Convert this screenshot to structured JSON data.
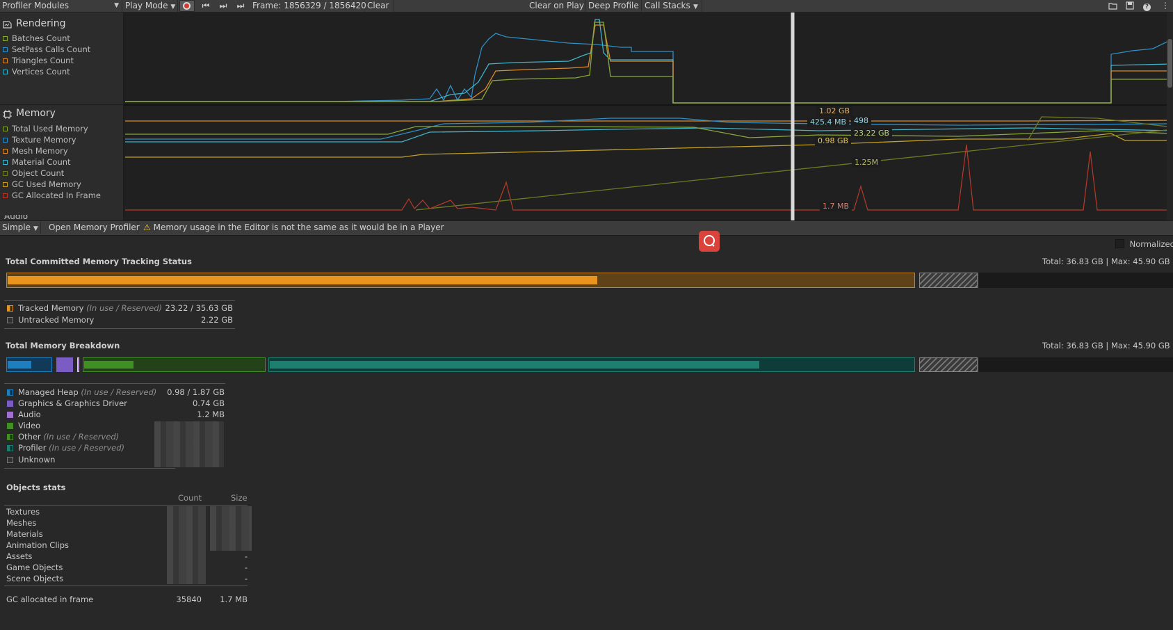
{
  "toolbar": {
    "modules_label": "Profiler Modules",
    "play_mode_label": "Play Mode",
    "frame_label": "Frame: 1856329 / 1856420",
    "clear_label": "Clear",
    "clear_on_play_label": "Clear on Play",
    "deep_profile_label": "Deep Profile",
    "call_stacks_label": "Call Stacks"
  },
  "rendering": {
    "title": "Rendering",
    "legend": [
      {
        "label": "Batches Count",
        "color": "#8aa83a"
      },
      {
        "label": "SetPass Calls Count",
        "color": "#2f8fc7"
      },
      {
        "label": "Triangles Count",
        "color": "#d98b2b"
      },
      {
        "label": "Vertices Count",
        "color": "#3fb3c8"
      }
    ]
  },
  "memory_module": {
    "title": "Memory",
    "legend": [
      {
        "label": "Total Used Memory",
        "color": "#8aa83a"
      },
      {
        "label": "Texture Memory",
        "color": "#2f8fc7"
      },
      {
        "label": "Mesh Memory",
        "color": "#d98b2b"
      },
      {
        "label": "Material Count",
        "color": "#3fb3c8"
      },
      {
        "label": "Object Count",
        "color": "#6e7a22"
      },
      {
        "label": "GC Used Memory",
        "color": "#c2a124"
      },
      {
        "label": "GC Allocated In Frame",
        "color": "#b83a2a"
      }
    ],
    "next_module": "Audio",
    "readouts": {
      "r1": "1.02 GB",
      "r2": "425.4 MB",
      "r3": "498",
      "r4": "23.22 GB",
      "r5": "0.98 GB",
      "r6": "1.25M",
      "r7": "1.7 MB"
    }
  },
  "detail_toolbar": {
    "view_mode": "Simple",
    "open_memory_profiler": "Open Memory Profiler",
    "warning": "Memory usage in the Editor is not the same as it would be in a Player"
  },
  "normalized_label": "Normalized",
  "committed": {
    "title": "Total Committed Memory Tracking Status",
    "total": "Total: 36.83 GB | Max: 45.90 GB",
    "tracked_fill": 0.651,
    "rows": [
      {
        "label": "Tracked Memory",
        "note": "(In use / Reserved)",
        "value": "23.22 / 35.63 GB",
        "color": "#e8941e"
      },
      {
        "label": "Untracked Memory",
        "note": "",
        "value": "2.22 GB",
        "color": "#555555"
      }
    ]
  },
  "breakdown": {
    "title": "Total Memory Breakdown",
    "total": "Total: 36.83 GB | Max: 45.90 GB",
    "rows": [
      {
        "label": "Managed Heap",
        "note": "(In use / Reserved)",
        "value": "0.98 / 1.87 GB",
        "color": "#1d7fc0"
      },
      {
        "label": "Graphics & Graphics Driver",
        "note": "",
        "value": "0.74 GB",
        "color": "#7b5cc4"
      },
      {
        "label": "Audio",
        "note": "",
        "value": "1.2 MB",
        "color": "#a070d0"
      },
      {
        "label": "Video",
        "note": "",
        "value": "",
        "color": "#3f8f22"
      },
      {
        "label": "Other",
        "note": "(In use / Reserved)",
        "value": "",
        "color": "#3f8f22"
      },
      {
        "label": "Profiler",
        "note": "(In use / Reserved)",
        "value": "",
        "color": "#1d7f6f"
      },
      {
        "label": "Unknown",
        "note": "",
        "value": "",
        "color": "#555555"
      }
    ]
  },
  "objects": {
    "title": "Objects stats",
    "col_count": "Count",
    "col_size": "Size",
    "rows": [
      {
        "label": "Textures",
        "size": ""
      },
      {
        "label": "Meshes",
        "size": ""
      },
      {
        "label": "Materials",
        "size": ""
      },
      {
        "label": "Animation Clips",
        "size": ""
      },
      {
        "label": "Assets",
        "size": "-"
      },
      {
        "label": "Game Objects",
        "size": "-"
      },
      {
        "label": "Scene Objects",
        "size": "-"
      }
    ],
    "gc": {
      "label": "GC allocated in frame",
      "count": "35840",
      "size": "1.7 MB"
    }
  }
}
